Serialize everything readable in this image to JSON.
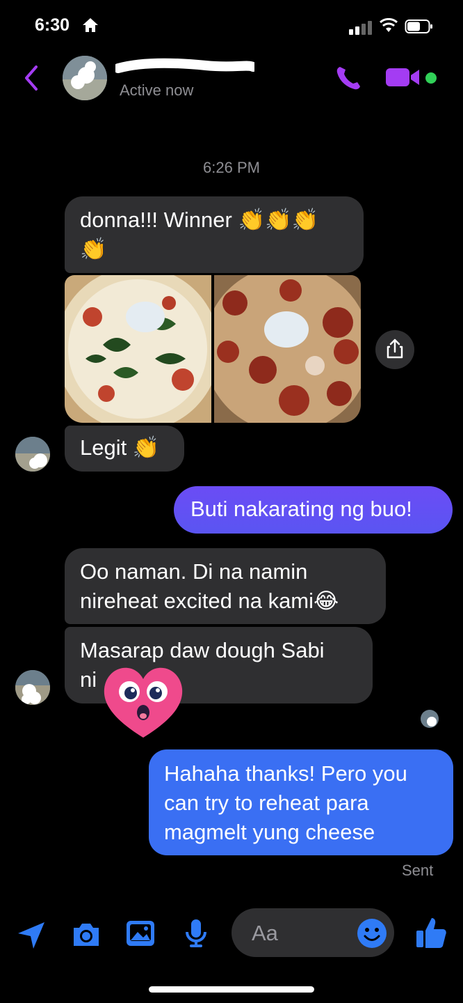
{
  "status_bar": {
    "time": "6:30"
  },
  "header": {
    "active_status": "Active now"
  },
  "thread": {
    "timestamp": "6:26 PM",
    "messages": [
      {
        "from": "them",
        "text_line1": "donna!!! Winner 👏👏👏",
        "text_line2": "👏"
      },
      {
        "from": "them",
        "text": "Legit 👏"
      },
      {
        "from": "me",
        "text": "Buti nakarating ng buo!"
      },
      {
        "from": "them",
        "text_line1": "Oo naman. Di na namin",
        "text_line2": "nireheat excited na kami😂"
      },
      {
        "from": "them",
        "text_line1": "Masarap daw dough Sabi",
        "text_line2": "ni"
      },
      {
        "from": "me",
        "text_line1": "Hahaha thanks! Pero you",
        "text_line2": "can try to reheat para",
        "text_line3": "magmelt yung cheese"
      }
    ],
    "delivery_status": "Sent"
  },
  "composer": {
    "placeholder": "Aa"
  },
  "icons": [
    "home-icon",
    "signal-icon",
    "wifi-icon",
    "battery-icon",
    "back-chevron-icon",
    "phone-icon",
    "video-camera-icon",
    "share-icon",
    "location-arrow-icon",
    "camera-icon",
    "gallery-icon",
    "microphone-icon",
    "emoji-icon",
    "thumbs-up-icon"
  ],
  "colors": {
    "accent_purple": "#a43cf3",
    "accent_blue": "#3a6ff3",
    "online": "#31d158"
  }
}
